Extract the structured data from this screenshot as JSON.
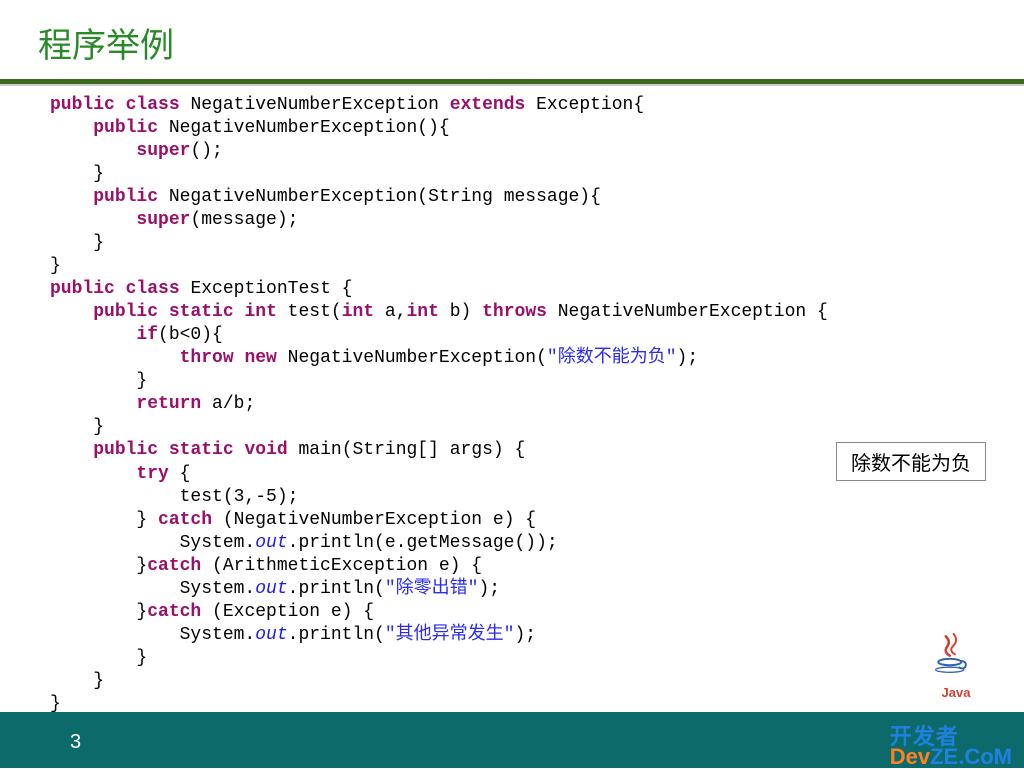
{
  "title": "程序举例",
  "pageNumber": "3",
  "outputText": "除数不能为负",
  "javaLabel": "Java",
  "devze": {
    "cn": "开发者",
    "en_left": "Dev",
    "en_right": "ZE.CoM"
  },
  "code": {
    "tokens": [
      [
        {
          "t": "public",
          "c": "kw"
        },
        {
          "t": " ",
          "c": ""
        },
        {
          "t": "class",
          "c": "kw"
        },
        {
          "t": " NegativeNumberException ",
          "c": "cls"
        },
        {
          "t": "extends",
          "c": "kw"
        },
        {
          "t": " Exception{",
          "c": "cls"
        }
      ],
      [
        {
          "t": "    ",
          "c": ""
        },
        {
          "t": "public",
          "c": "kw"
        },
        {
          "t": " NegativeNumberException(){",
          "c": "cls"
        }
      ],
      [
        {
          "t": "        ",
          "c": ""
        },
        {
          "t": "super",
          "c": "kw"
        },
        {
          "t": "();",
          "c": ""
        }
      ],
      [
        {
          "t": "    }",
          "c": ""
        }
      ],
      [
        {
          "t": "    ",
          "c": ""
        },
        {
          "t": "public",
          "c": "kw"
        },
        {
          "t": " NegativeNumberException(String message){",
          "c": "cls"
        }
      ],
      [
        {
          "t": "        ",
          "c": ""
        },
        {
          "t": "super",
          "c": "kw"
        },
        {
          "t": "(message);",
          "c": ""
        }
      ],
      [
        {
          "t": "    }",
          "c": ""
        }
      ],
      [
        {
          "t": "}",
          "c": ""
        }
      ],
      [
        {
          "t": "public",
          "c": "kw"
        },
        {
          "t": " ",
          "c": ""
        },
        {
          "t": "class",
          "c": "kw"
        },
        {
          "t": " ExceptionTest {",
          "c": "cls"
        }
      ],
      [
        {
          "t": "    ",
          "c": ""
        },
        {
          "t": "public",
          "c": "kw"
        },
        {
          "t": " ",
          "c": ""
        },
        {
          "t": "static",
          "c": "kw"
        },
        {
          "t": " ",
          "c": ""
        },
        {
          "t": "int",
          "c": "kw"
        },
        {
          "t": " test(",
          "c": ""
        },
        {
          "t": "int",
          "c": "kw"
        },
        {
          "t": " a,",
          "c": ""
        },
        {
          "t": "int",
          "c": "kw"
        },
        {
          "t": " b) ",
          "c": ""
        },
        {
          "t": "throws",
          "c": "kw"
        },
        {
          "t": " NegativeNumberException {",
          "c": ""
        }
      ],
      [
        {
          "t": "        ",
          "c": ""
        },
        {
          "t": "if",
          "c": "kw"
        },
        {
          "t": "(b<0){",
          "c": ""
        }
      ],
      [
        {
          "t": "            ",
          "c": ""
        },
        {
          "t": "throw",
          "c": "kw"
        },
        {
          "t": " ",
          "c": ""
        },
        {
          "t": "new",
          "c": "kw"
        },
        {
          "t": " NegativeNumberException(",
          "c": ""
        },
        {
          "t": "\"除数不能为负\"",
          "c": "str"
        },
        {
          "t": ");",
          "c": ""
        }
      ],
      [
        {
          "t": "        }",
          "c": ""
        }
      ],
      [
        {
          "t": "        ",
          "c": ""
        },
        {
          "t": "return",
          "c": "kw"
        },
        {
          "t": " a/b;",
          "c": ""
        }
      ],
      [
        {
          "t": "    }",
          "c": ""
        }
      ],
      [
        {
          "t": "    ",
          "c": ""
        },
        {
          "t": "public",
          "c": "kw"
        },
        {
          "t": " ",
          "c": ""
        },
        {
          "t": "static",
          "c": "kw"
        },
        {
          "t": " ",
          "c": ""
        },
        {
          "t": "void",
          "c": "kw"
        },
        {
          "t": " main(String[] args) {",
          "c": ""
        }
      ],
      [
        {
          "t": "        ",
          "c": ""
        },
        {
          "t": "try",
          "c": "kw"
        },
        {
          "t": " {",
          "c": ""
        }
      ],
      [
        {
          "t": "            ",
          "c": ""
        },
        {
          "t": "test",
          "c": "cls"
        },
        {
          "t": "(3,-5);",
          "c": ""
        }
      ],
      [
        {
          "t": "        } ",
          "c": ""
        },
        {
          "t": "catch",
          "c": "kw"
        },
        {
          "t": " (NegativeNumberException e) {",
          "c": ""
        }
      ],
      [
        {
          "t": "            System.",
          "c": ""
        },
        {
          "t": "out",
          "c": "fld"
        },
        {
          "t": ".println(e.getMessage());",
          "c": ""
        }
      ],
      [
        {
          "t": "        }",
          "c": ""
        },
        {
          "t": "catch",
          "c": "kw"
        },
        {
          "t": " (ArithmeticException e) {",
          "c": ""
        }
      ],
      [
        {
          "t": "            System.",
          "c": ""
        },
        {
          "t": "out",
          "c": "fld"
        },
        {
          "t": ".println(",
          "c": ""
        },
        {
          "t": "\"除零出错\"",
          "c": "str"
        },
        {
          "t": ");",
          "c": ""
        }
      ],
      [
        {
          "t": "        }",
          "c": ""
        },
        {
          "t": "catch",
          "c": "kw"
        },
        {
          "t": " (Exception e) {",
          "c": ""
        }
      ],
      [
        {
          "t": "            System.",
          "c": ""
        },
        {
          "t": "out",
          "c": "fld"
        },
        {
          "t": ".println(",
          "c": ""
        },
        {
          "t": "\"其他异常发生\"",
          "c": "str"
        },
        {
          "t": ");",
          "c": ""
        }
      ],
      [
        {
          "t": "        }",
          "c": ""
        }
      ],
      [
        {
          "t": "    }",
          "c": ""
        }
      ],
      [
        {
          "t": "}",
          "c": ""
        }
      ]
    ]
  }
}
